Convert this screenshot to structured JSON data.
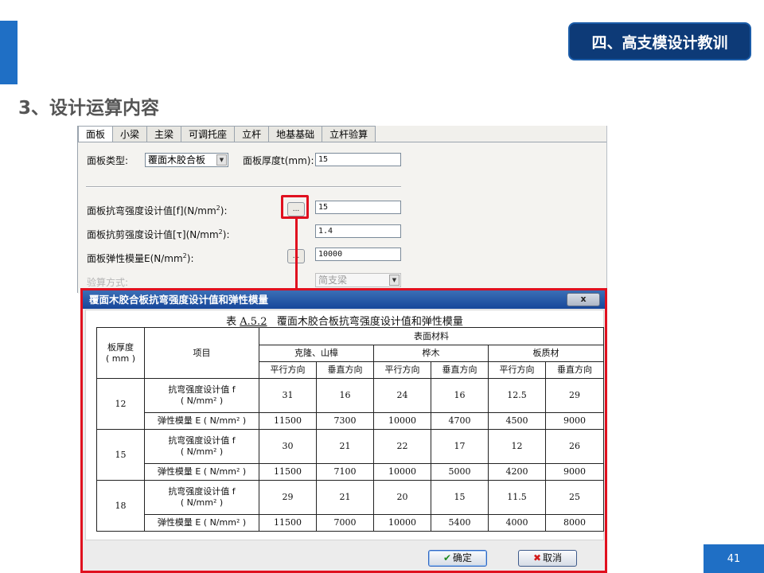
{
  "slide": {
    "header_badge": "四、高支模设计教训",
    "section_title": "3、设计运算内容",
    "page_number": "41"
  },
  "window": {
    "tabs": [
      "面板",
      "小梁",
      "主梁",
      "可调托座",
      "立杆",
      "地基基础",
      "立杆验算"
    ],
    "active_tab": "面板",
    "panel_type_label": "面板类型:",
    "panel_type_value": "覆面木胶合板",
    "thickness_label": "面板厚度t(mm):",
    "thickness_value": "15",
    "bending_label": "面板抗弯强度设计值[f](N/mm",
    "bending_value": "15",
    "shear_label": "面板抗剪强度设计值[τ](N/mm",
    "shear_value": "1.4",
    "elastic_label": "面板弹性模量E(N/mm",
    "elastic_value": "10000",
    "calc_method_label": "验算方式:",
    "calc_method_value": "简支梁",
    "ellipsis_button": "...",
    "unit_sup": "2",
    "label_tail": "):"
  },
  "dialog": {
    "title": "覆面木胶合板抗弯强度设计值和弹性模量",
    "close": "x",
    "caption_prefix": "表",
    "caption_code": "A.5.2",
    "caption_text": "覆面木胶合板抗弯强度设计值和弹性模量",
    "ok": "确定",
    "cancel": "取消"
  },
  "table": {
    "col_thickness_line1": "板厚度",
    "col_thickness_line2": "( mm )",
    "col_item": "项目",
    "surface_material": "表面材料",
    "materials": [
      "克隆、山樟",
      "桦木",
      "板质材"
    ],
    "directions": [
      "平行方向",
      "垂直方向",
      "平行方向",
      "垂直方向",
      "平行方向",
      "垂直方向"
    ],
    "item_bending_line1": "抗弯强度设计值 f",
    "item_bending_line2": "( N/mm² )",
    "item_elastic": "弹性模量 E ( N/mm² )",
    "rows": [
      {
        "thickness": "12",
        "bending": [
          "31",
          "16",
          "24",
          "16",
          "12.5",
          "29"
        ],
        "elastic": [
          "11500",
          "7300",
          "10000",
          "4700",
          "4500",
          "9000"
        ]
      },
      {
        "thickness": "15",
        "bending": [
          "30",
          "21",
          "22",
          "17",
          "12",
          "26"
        ],
        "elastic": [
          "11500",
          "7100",
          "10000",
          "5000",
          "4200",
          "9000"
        ]
      },
      {
        "thickness": "18",
        "bending": [
          "29",
          "21",
          "20",
          "15",
          "11.5",
          "25"
        ],
        "elastic": [
          "11500",
          "7000",
          "10000",
          "5400",
          "4000",
          "8000"
        ]
      }
    ]
  },
  "colors": {
    "accent_blue": "#1f6fc5",
    "badge_navy": "#0d3a77",
    "highlight_red": "#e0101f"
  }
}
